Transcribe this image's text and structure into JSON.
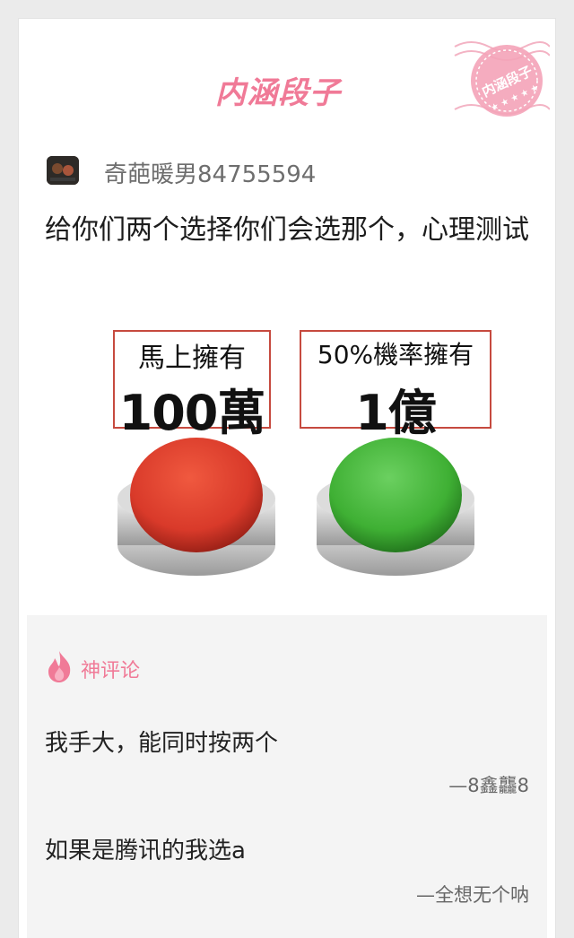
{
  "header": {
    "brand": "内涵段子",
    "stamp_text": "内涵段子"
  },
  "post": {
    "author": "奇葩暖男84755594",
    "title": "给你们两个选择你们会选那个，心理测试",
    "image": {
      "left_option_top": "馬上擁有",
      "left_option_bottom": "100萬",
      "right_option_top": "50%機率擁有",
      "right_option_bottom": "1億",
      "left_button_color": "#d93a2a",
      "right_button_color": "#3fb034"
    }
  },
  "comments": {
    "section_label": "神评论",
    "items": [
      {
        "text": "我手大，能同时按两个",
        "author": "—8鑫龘8"
      },
      {
        "text": "如果是腾讯的我选a",
        "author": "—全想无个呐"
      }
    ]
  },
  "colors": {
    "brand_pink": "#f07a97",
    "comments_bg": "#f4f4f4"
  }
}
